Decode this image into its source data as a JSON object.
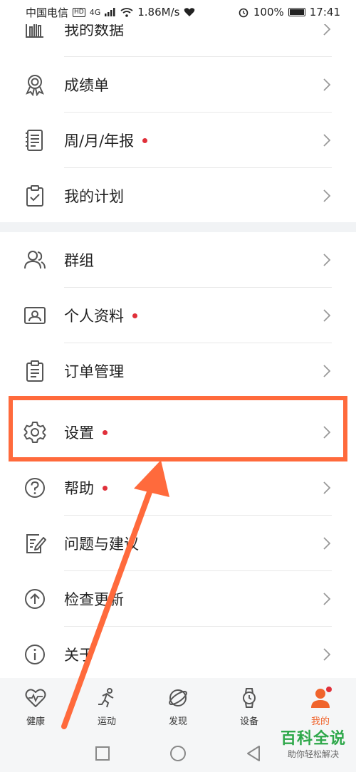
{
  "status_bar": {
    "carrier": "中国电信",
    "hd": "HD",
    "network": "4G",
    "speed": "1.86M/s",
    "battery": "100%",
    "time": "17:41"
  },
  "menu_section_1": [
    {
      "label": "我的数据",
      "icon": "bar-chart-icon",
      "dot": false
    },
    {
      "label": "成绩单",
      "icon": "medal-icon",
      "dot": false
    },
    {
      "label": "周/月/年报",
      "icon": "report-book-icon",
      "dot": true
    },
    {
      "label": "我的计划",
      "icon": "clipboard-check-icon",
      "dot": false
    }
  ],
  "menu_section_2": [
    {
      "label": "群组",
      "icon": "group-icon",
      "dot": false
    },
    {
      "label": "个人资料",
      "icon": "id-card-icon",
      "dot": true
    },
    {
      "label": "订单管理",
      "icon": "order-list-icon",
      "dot": false
    },
    {
      "label": "设置",
      "icon": "gear-icon",
      "dot": true
    },
    {
      "label": "帮助",
      "icon": "help-icon",
      "dot": true
    },
    {
      "label": "问题与建议",
      "icon": "feedback-icon",
      "dot": false
    },
    {
      "label": "检查更新",
      "icon": "update-arrow-icon",
      "dot": false
    },
    {
      "label": "关于",
      "icon": "info-icon",
      "dot": false
    }
  ],
  "tab_bar": {
    "tabs": [
      {
        "label": "健康",
        "icon": "heart-pulse-icon",
        "active": false
      },
      {
        "label": "运动",
        "icon": "runner-icon",
        "active": false
      },
      {
        "label": "发现",
        "icon": "planet-icon",
        "active": false
      },
      {
        "label": "设备",
        "icon": "watch-icon",
        "active": false
      },
      {
        "label": "我的",
        "icon": "user-icon",
        "active": true
      }
    ]
  },
  "watermark": {
    "main": "百科全说",
    "sub": "助你轻松解决"
  },
  "colors": {
    "accent": "#f0642c",
    "badge": "#e0303a",
    "annotation": "#ff6a3c",
    "watermark": "#2ea84a"
  }
}
